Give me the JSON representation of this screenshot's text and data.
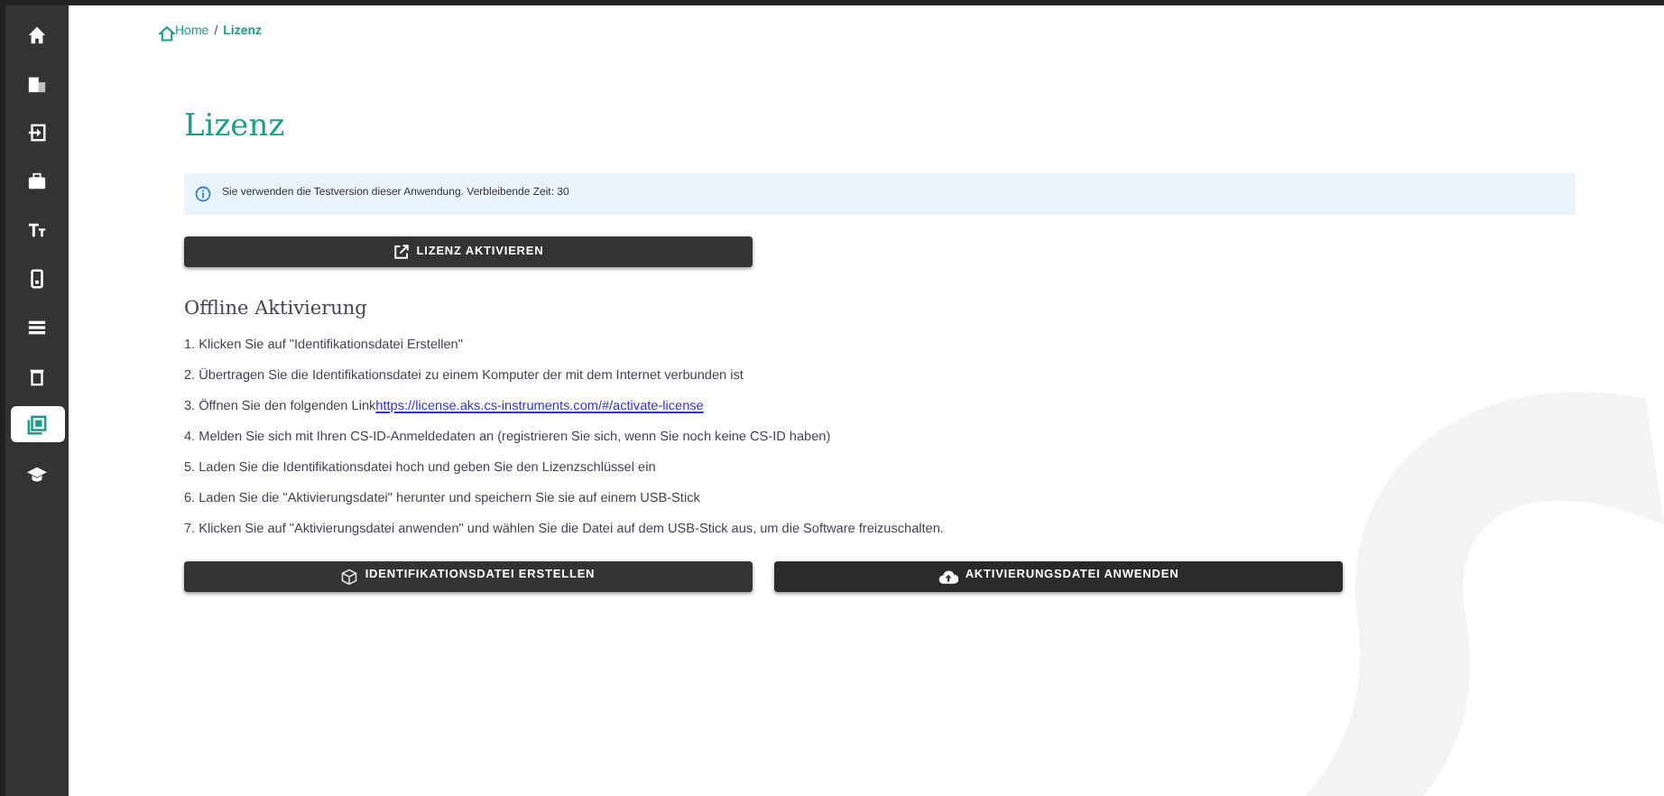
{
  "sidebar": {
    "items": [
      {
        "selected": false
      },
      {
        "selected": false
      },
      {
        "selected": false
      },
      {
        "selected": false
      },
      {
        "selected": false
      },
      {
        "selected": false
      },
      {
        "selected": false
      },
      {
        "selected": false
      },
      {
        "selected": true
      },
      {
        "selected": false
      }
    ]
  },
  "breadcrumb": [
    {
      "label": "Home",
      "kind": "home"
    },
    {
      "label": "/",
      "kind": "separator"
    },
    {
      "label": "Lizenz",
      "kind": "current"
    }
  ],
  "page_title": "Lizenz",
  "alert": {
    "text": "Sie verwenden die Testversion dieser Anwendung. Verbleibende Zeit: 30"
  },
  "activate_button": "LIZENZ AKTIVIEREN",
  "offline": {
    "heading": "Offline Aktivierung",
    "steps": [
      {
        "text": "1. Klicken Sie auf  \"Identifikationsdatei Erstellen\""
      },
      {
        "text": "2. Übertragen Sie die Identifikationsdatei zu einem Komputer der mit dem Internet verbunden ist"
      },
      {
        "text": "3. Öffnen Sie den folgenden Link",
        "link": "https://license.aks.cs-instruments.com/#/activate-license"
      },
      {
        "text": "4. Melden Sie sich mit Ihren CS-ID-Anmeldedaten an (registrieren Sie sich, wenn Sie noch keine CS-ID haben)"
      },
      {
        "text": "5. Laden Sie die Identifikationsdatei hoch und geben Sie den Lizenzschlüssel ein"
      },
      {
        "text": "6. Laden Sie die \"Aktivierungsdatei\" herunter und speichern Sie sie auf einem USB-Stick"
      },
      {
        "text": "7. Klicken Sie auf \"Aktivierungsdatei anwenden\" und wählen Sie die Datei auf dem USB-Stick aus, um die Software freizuschalten."
      }
    ]
  },
  "buttons": [
    {
      "label": "IDENTIFIKATIONSDATEI ERSTELLEN",
      "kind": "create"
    },
    {
      "label": "AKTIVIERUNGSDATEI ANWENDEN",
      "kind": "upload"
    }
  ]
}
